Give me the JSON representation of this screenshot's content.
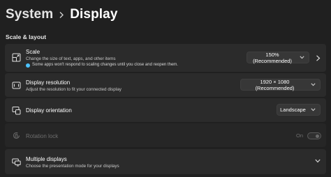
{
  "breadcrumb": {
    "parent": "System",
    "separator_icon": "chevron-right-icon",
    "current": "Display"
  },
  "section": {
    "title": "Scale & layout"
  },
  "scale": {
    "icon": "scale-icon",
    "title": "Scale",
    "subtitle": "Change the size of text, apps, and other items",
    "note": "Some apps won't respond to scaling changes until you close and reopen them.",
    "note_color": "#4cc2ff",
    "value": "150% (Recommended)"
  },
  "resolution": {
    "icon": "resolution-icon",
    "title": "Display resolution",
    "subtitle": "Adjust the resolution to fit your connected display",
    "value": "1920 × 1080 (Recommended)"
  },
  "orientation": {
    "icon": "orientation-icon",
    "title": "Display orientation",
    "value": "Landscape"
  },
  "rotation_lock": {
    "icon": "rotation-lock-icon",
    "title": "Rotation lock",
    "state_label": "On",
    "enabled": false
  },
  "multiple_displays": {
    "icon": "multiple-displays-icon",
    "title": "Multiple displays",
    "subtitle": "Choose the presentation mode for your displays"
  },
  "colors": {
    "background": "#202020",
    "card": "#2b2b2b",
    "accent": "#4cc2ff"
  }
}
